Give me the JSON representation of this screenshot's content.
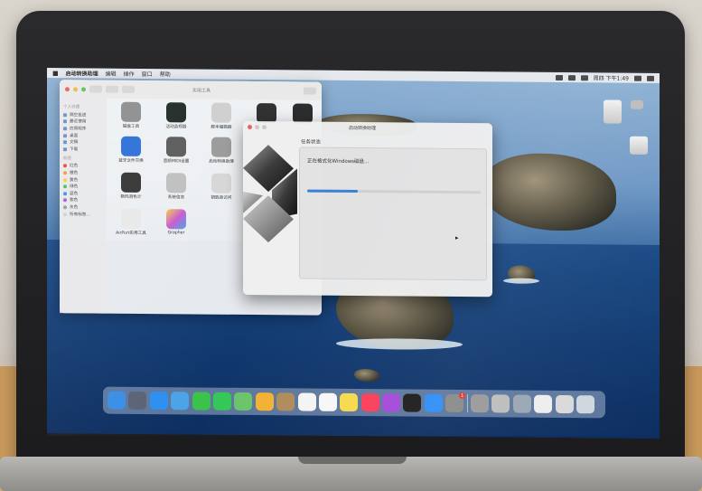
{
  "menubar": {
    "app_name": "启动转换助理",
    "items": [
      "编辑",
      "操作",
      "窗口",
      "帮助"
    ],
    "status": "周四 下午1:49"
  },
  "finder": {
    "title": "实用工具",
    "sidebar": {
      "sections": [
        {
          "label": "个人收藏",
          "items": [
            "隔空投送",
            "最近使用",
            "应用程序",
            "桌面",
            "文稿",
            "下载"
          ]
        },
        {
          "label": "标签",
          "items": [
            "红色",
            "橙色",
            "黄色",
            "绿色",
            "蓝色",
            "紫色",
            "灰色",
            "所有标签..."
          ]
        }
      ]
    },
    "apps": [
      {
        "label": "磁盘工具",
        "icon": "disk-utility-icon",
        "color": "#8d8d8d"
      },
      {
        "label": "活动监视器",
        "icon": "activity-monitor-icon",
        "color": "#1f2a24"
      },
      {
        "label": "脚本编辑器",
        "icon": "script-editor-icon",
        "color": "#cfcfcf"
      },
      {
        "label": "",
        "icon": "terminal-icon",
        "color": "#2f2f2f"
      },
      {
        "label": "",
        "icon": "console-icon",
        "color": "#2b2b2b"
      },
      {
        "label": "蓝牙文件交换",
        "icon": "bluetooth-icon",
        "color": "#2c6fd6"
      },
      {
        "label": "音频MIDI设置",
        "icon": "audio-midi-icon",
        "color": "#5a5a5a"
      },
      {
        "label": "启动转换助理",
        "icon": "boot-camp-icon",
        "color": "#9a9a9a"
      },
      {
        "label": "数码测色计",
        "icon": "color-meter-icon",
        "color": "#333333"
      },
      {
        "label": "系统信息",
        "icon": "system-info-icon",
        "color": "#bfbfbf"
      },
      {
        "label": "钥匙串访问",
        "icon": "keychain-icon",
        "color": "#d6d6d6"
      },
      {
        "label": "AirPort实用工具",
        "icon": "airport-utility-icon",
        "color": "#e8e8e8"
      },
      {
        "label": "Grapher",
        "icon": "grapher-icon",
        "color": "#c85ad0"
      }
    ]
  },
  "dialog": {
    "title": "启动转换助理",
    "panel_title": "任务状态",
    "status_text": "正在格式化Windows磁盘...",
    "progress": 0.29,
    "logo": "windows-logo-icon"
  },
  "dock": {
    "badge_count": "1",
    "apps": [
      {
        "name": "finder-icon",
        "color": "#3a8ee6"
      },
      {
        "name": "launchpad-icon",
        "color": "#5a6274"
      },
      {
        "name": "safari-icon",
        "color": "#2c8ff0"
      },
      {
        "name": "mail-icon",
        "color": "#4aa3e8"
      },
      {
        "name": "facetime-icon",
        "color": "#3bc24a"
      },
      {
        "name": "messages-icon",
        "color": "#35c759"
      },
      {
        "name": "maps-icon",
        "color": "#6cc36a"
      },
      {
        "name": "photos-icon",
        "color": "#f2b134"
      },
      {
        "name": "contacts-icon",
        "color": "#b08a5a"
      },
      {
        "name": "calendar-icon",
        "color": "#f4f4f4"
      },
      {
        "name": "reminders-icon",
        "color": "#f7f7f7"
      },
      {
        "name": "notes-icon",
        "color": "#f6d94a"
      },
      {
        "name": "music-icon",
        "color": "#fa3d5a"
      },
      {
        "name": "podcasts-icon",
        "color": "#a449d8"
      },
      {
        "name": "tv-icon",
        "color": "#1c1c1c"
      },
      {
        "name": "app-store-icon",
        "color": "#2f8ef5"
      },
      {
        "name": "system-preferences-icon",
        "color": "#8a8a8a"
      },
      {
        "name": "boot-camp-assistant-icon",
        "color": "#9a9a9a"
      },
      {
        "name": "disk-utility-icon",
        "color": "#bdbdbd"
      },
      {
        "name": "installer-icon",
        "color": "#9aa6b4"
      },
      {
        "name": "document-icon",
        "color": "#eeeeee"
      },
      {
        "name": "disk-image-icon",
        "color": "#d9d9d9"
      },
      {
        "name": "trash-icon",
        "color": "#cfd6de"
      }
    ]
  }
}
